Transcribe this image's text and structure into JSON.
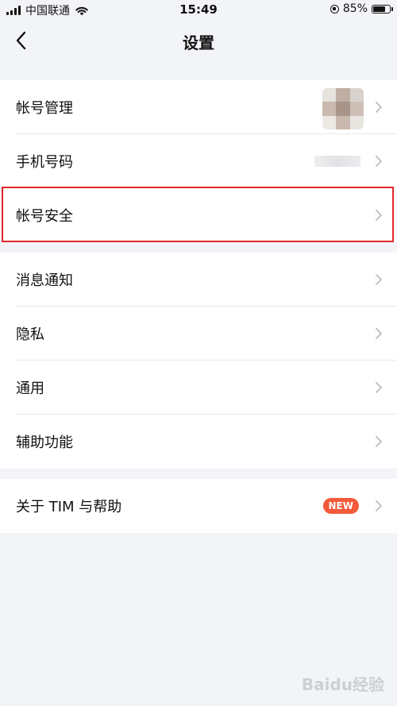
{
  "status_bar": {
    "carrier": "中国联通",
    "time": "15:49",
    "battery": "85%",
    "battery_level": 0.85
  },
  "nav": {
    "title": "设置"
  },
  "group1": {
    "items": [
      {
        "label": "帐号管理"
      },
      {
        "label": "手机号码"
      },
      {
        "label": "帐号安全"
      }
    ]
  },
  "group2": {
    "items": [
      {
        "label": "消息通知"
      },
      {
        "label": "隐私"
      },
      {
        "label": "通用"
      },
      {
        "label": "辅助功能"
      }
    ]
  },
  "group3": {
    "items": [
      {
        "label": "关于 TIM 与帮助",
        "badge": "NEW"
      }
    ]
  },
  "colors": {
    "background": "#f2f4f8",
    "highlight": "#e0282c",
    "badge": "#f25a3a",
    "chevron": "#b9bcc3"
  },
  "watermark": "Baidu经验"
}
